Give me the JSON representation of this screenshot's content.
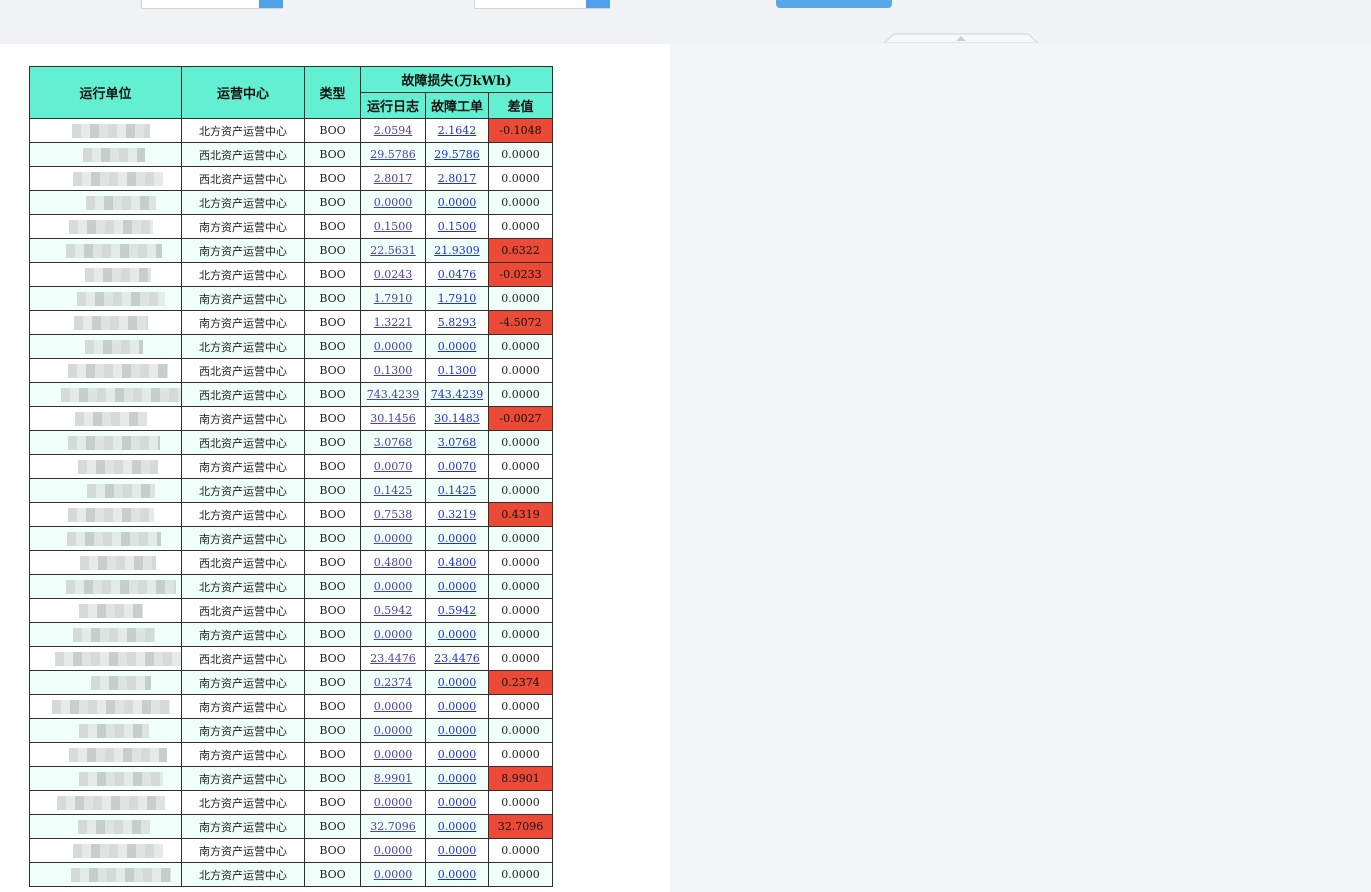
{
  "table": {
    "headers": {
      "unit": "运行单位",
      "center": "运营中心",
      "type": "类型",
      "fault_loss": "故障损失(万kWh)",
      "log": "运行日志",
      "work_order": "故障工单",
      "diff": "差值"
    },
    "rows": [
      {
        "center": "北方资产运营中心",
        "type": "BOO",
        "log": "2.0594",
        "work_order": "2.1642",
        "diff": "-0.1048",
        "flag": "neg"
      },
      {
        "center": "西北资产运营中心",
        "type": "BOO",
        "log": "29.5786",
        "work_order": "29.5786",
        "diff": "0.0000",
        "flag": ""
      },
      {
        "center": "西北资产运营中心",
        "type": "BOO",
        "log": "2.8017",
        "work_order": "2.8017",
        "diff": "0.0000",
        "flag": ""
      },
      {
        "center": "北方资产运营中心",
        "type": "BOO",
        "log": "0.0000",
        "work_order": "0.0000",
        "diff": "0.0000",
        "flag": ""
      },
      {
        "center": "南方资产运营中心",
        "type": "BOO",
        "log": "0.1500",
        "work_order": "0.1500",
        "diff": "0.0000",
        "flag": ""
      },
      {
        "center": "南方资产运营中心",
        "type": "BOO",
        "log": "22.5631",
        "work_order": "21.9309",
        "diff": "0.6322",
        "flag": "pos"
      },
      {
        "center": "北方资产运营中心",
        "type": "BOO",
        "log": "0.0243",
        "work_order": "0.0476",
        "diff": "-0.0233",
        "flag": "neg"
      },
      {
        "center": "南方资产运营中心",
        "type": "BOO",
        "log": "1.7910",
        "work_order": "1.7910",
        "diff": "0.0000",
        "flag": ""
      },
      {
        "center": "南方资产运营中心",
        "type": "BOO",
        "log": "1.3221",
        "work_order": "5.8293",
        "diff": "-4.5072",
        "flag": "neg"
      },
      {
        "center": "北方资产运营中心",
        "type": "BOO",
        "log": "0.0000",
        "work_order": "0.0000",
        "diff": "0.0000",
        "flag": ""
      },
      {
        "center": "西北资产运营中心",
        "type": "BOO",
        "log": "0.1300",
        "work_order": "0.1300",
        "diff": "0.0000",
        "flag": ""
      },
      {
        "center": "西北资产运营中心",
        "type": "BOO",
        "log": "743.4239",
        "work_order": "743.4239",
        "diff": "0.0000",
        "flag": ""
      },
      {
        "center": "南方资产运营中心",
        "type": "BOO",
        "log": "30.1456",
        "work_order": "30.1483",
        "diff": "-0.0027",
        "flag": "neg"
      },
      {
        "center": "西北资产运营中心",
        "type": "BOO",
        "log": "3.0768",
        "work_order": "3.0768",
        "diff": "0.0000",
        "flag": ""
      },
      {
        "center": "南方资产运营中心",
        "type": "BOO",
        "log": "0.0070",
        "work_order": "0.0070",
        "diff": "0.0000",
        "flag": ""
      },
      {
        "center": "北方资产运营中心",
        "type": "BOO",
        "log": "0.1425",
        "work_order": "0.1425",
        "diff": "0.0000",
        "flag": ""
      },
      {
        "center": "北方资产运营中心",
        "type": "BOO",
        "log": "0.7538",
        "work_order": "0.3219",
        "diff": "0.4319",
        "flag": "pos"
      },
      {
        "center": "南方资产运营中心",
        "type": "BOO",
        "log": "0.0000",
        "work_order": "0.0000",
        "diff": "0.0000",
        "flag": ""
      },
      {
        "center": "西北资产运营中心",
        "type": "BOO",
        "log": "0.4800",
        "work_order": "0.4800",
        "diff": "0.0000",
        "flag": ""
      },
      {
        "center": "北方资产运营中心",
        "type": "BOO",
        "log": "0.0000",
        "work_order": "0.0000",
        "diff": "0.0000",
        "flag": ""
      },
      {
        "center": "西北资产运营中心",
        "type": "BOO",
        "log": "0.5942",
        "work_order": "0.5942",
        "diff": "0.0000",
        "flag": ""
      },
      {
        "center": "南方资产运营中心",
        "type": "BOO",
        "log": "0.0000",
        "work_order": "0.0000",
        "diff": "0.0000",
        "flag": ""
      },
      {
        "center": "西北资产运营中心",
        "type": "BOO",
        "log": "23.4476",
        "work_order": "23.4476",
        "diff": "0.0000",
        "flag": ""
      },
      {
        "center": "南方资产运营中心",
        "type": "BOO",
        "log": "0.2374",
        "work_order": "0.0000",
        "diff": "0.2374",
        "flag": "pos"
      },
      {
        "center": "南方资产运营中心",
        "type": "BOO",
        "log": "0.0000",
        "work_order": "0.0000",
        "diff": "0.0000",
        "flag": ""
      },
      {
        "center": "南方资产运营中心",
        "type": "BOO",
        "log": "0.0000",
        "work_order": "0.0000",
        "diff": "0.0000",
        "flag": ""
      },
      {
        "center": "南方资产运营中心",
        "type": "BOO",
        "log": "0.0000",
        "work_order": "0.0000",
        "diff": "0.0000",
        "flag": ""
      },
      {
        "center": "南方资产运营中心",
        "type": "BOO",
        "log": "8.9901",
        "work_order": "0.0000",
        "diff": "8.9901",
        "flag": "pos"
      },
      {
        "center": "北方资产运营中心",
        "type": "BOO",
        "log": "0.0000",
        "work_order": "0.0000",
        "diff": "0.0000",
        "flag": ""
      },
      {
        "center": "南方资产运营中心",
        "type": "BOO",
        "log": "32.7096",
        "work_order": "0.0000",
        "diff": "32.7096",
        "flag": "pos"
      },
      {
        "center": "南方资产运营中心",
        "type": "BOO",
        "log": "0.0000",
        "work_order": "0.0000",
        "diff": "0.0000",
        "flag": ""
      },
      {
        "center": "北方资产运营中心",
        "type": "BOO",
        "log": "0.0000",
        "work_order": "0.0000",
        "diff": "0.0000",
        "flag": ""
      }
    ]
  },
  "colors": {
    "header_bg": "#63f0d2",
    "highlight": "#ea4a36",
    "accent": "#57a9ec"
  }
}
